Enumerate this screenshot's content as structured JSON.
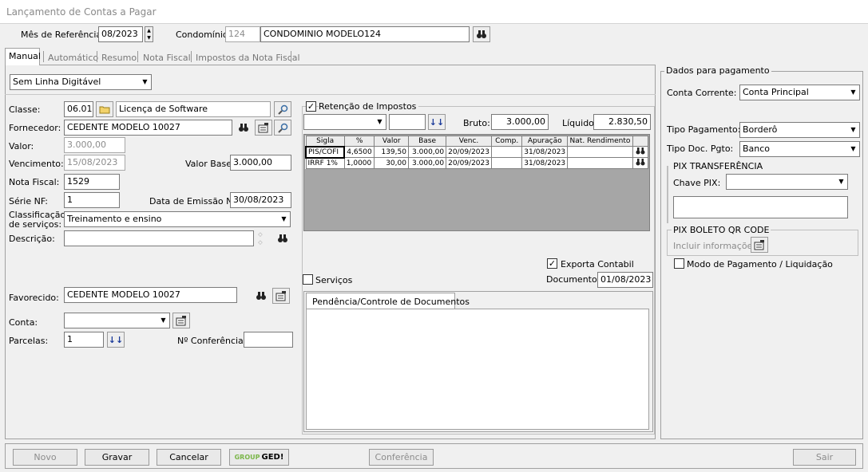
{
  "window": {
    "title": "Lançamento de Contas a Pagar"
  },
  "header": {
    "mes_label": "Mês de Referência:",
    "mes_value": "08/2023",
    "condominio_label": "Condomínio:",
    "condominio_code": "124",
    "condominio_name": "CONDOMINIO MODELO124"
  },
  "tabs": [
    "Manual",
    "Automático",
    "Resumo",
    "Nota Fiscal",
    "Impostos da Nota Fiscal"
  ],
  "linha_digitavel": "Sem Linha Digitável",
  "form": {
    "classe_label": "Classe:",
    "classe_code": "06.01",
    "classe_name": "Licença de Software",
    "fornecedor_label": "Fornecedor:",
    "fornecedor_value": "CEDENTE MODELO 10027",
    "valor_label": "Valor:",
    "valor_value": "3.000,00",
    "vencimento_label": "Vencimento:",
    "vencimento_value": "15/08/2023",
    "valor_base_label": "Valor Base:",
    "valor_base_value": "3.000,00",
    "nota_fiscal_label": "Nota Fiscal:",
    "nota_fiscal_value": "1529",
    "serie_label": "Série NF:",
    "serie_value": "1",
    "data_emissao_label": "Data de Emissão NF:",
    "data_emissao_value": "30/08/2023",
    "classificacao_label_1": "Classificação",
    "classificacao_label_2": "de serviços:",
    "classificacao_value": "Treinamento e ensino",
    "descricao_label": "Descrição:",
    "descricao_value": "",
    "favorecido_label": "Favorecido:",
    "favorecido_value": "CEDENTE MODELO 10027",
    "conta_label": "Conta:",
    "conta_value": "",
    "parcelas_label": "Parcelas:",
    "parcelas_value": "1",
    "conferencia_label": "Nº Conferência:",
    "conferencia_value": ""
  },
  "retencao": {
    "label": "Retenção de Impostos",
    "bruto_label": "Bruto:",
    "bruto_value": "3.000,00",
    "liquido_label": "Líquido:",
    "liquido_value": "2.830,50",
    "columns": [
      "Sigla",
      "%",
      "Valor",
      "Base",
      "Venc.",
      "Comp.",
      "Apuração",
      "Nat. Rendimento"
    ],
    "rows": [
      [
        "PIS/COFI",
        "4,6500",
        "139,50",
        "3.000,00",
        "20/09/2023",
        "",
        "31/08/2023",
        ""
      ],
      [
        "IRRF 1%",
        "1,0000",
        "30,00",
        "3.000,00",
        "20/09/2023",
        "",
        "31/08/2023",
        ""
      ]
    ]
  },
  "exporta_contabil": "Exporta Contabil",
  "servicos": "Serviços",
  "documento_label": "Documento:",
  "documento_value": "01/08/2023",
  "pendencia_tab": "Pendência/Controle de Documentos",
  "pagamento": {
    "title": "Dados para pagamento",
    "conta_corrente_label": "Conta Corrente:",
    "conta_corrente_value": "Conta Principal",
    "tipo_pagamento_label": "Tipo Pagamento:",
    "tipo_pagamento_value": "Borderô",
    "tipo_doc_label": "Tipo Doc. Pgto:",
    "tipo_doc_value": "Banco",
    "pix_title": "PIX TRANSFERÊNCIA",
    "chave_pix_label": "Chave PIX:",
    "chave_pix_value": "",
    "boleto_title": "PIX BOLETO QR CODE",
    "incluir_label": "Incluir informações:",
    "modo_label": "Modo de Pagamento / Liquidação"
  },
  "buttons": {
    "novo": "Novo",
    "gravar": "Gravar",
    "cancelar": "Cancelar",
    "ged_group": "GROUP",
    "ged_ged": "GED!",
    "conferencia": "Conferência",
    "sair": "Sair"
  },
  "colors": {
    "accent": "#cc0000",
    "ged_green": "#7ab648"
  }
}
